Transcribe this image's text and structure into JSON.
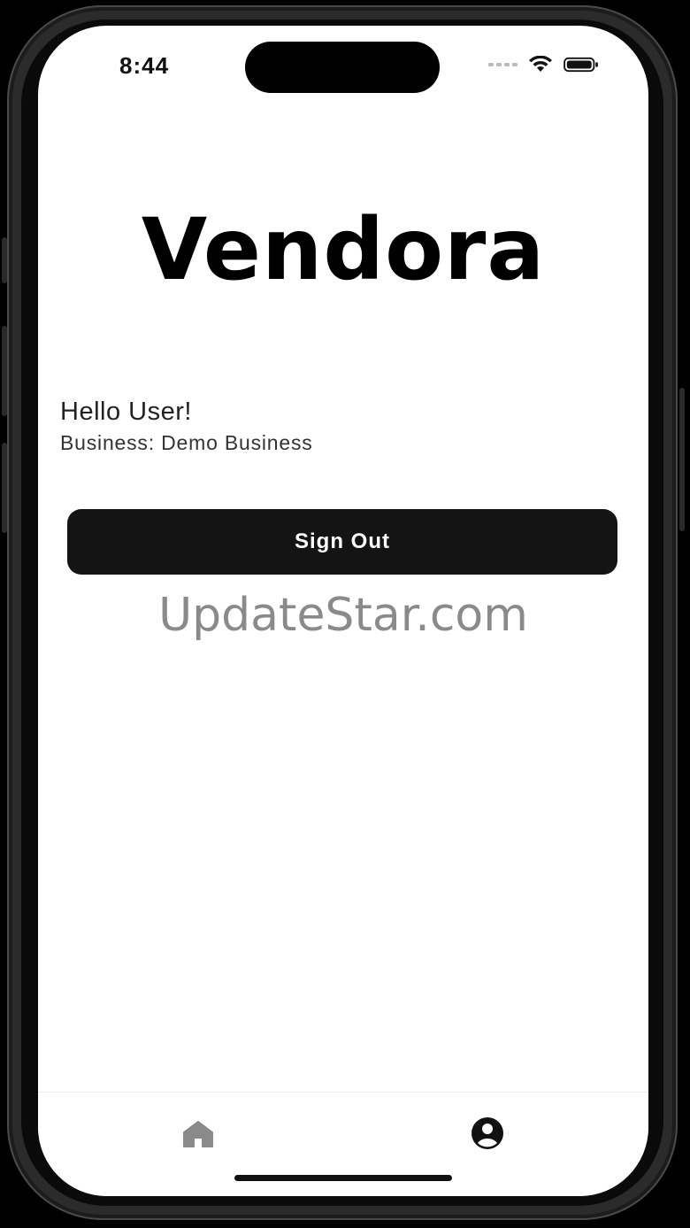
{
  "status_bar": {
    "time": "8:44",
    "icons": [
      "signal-dots-icon",
      "wifi-icon",
      "battery-icon"
    ]
  },
  "app": {
    "brand_title": "Vendora"
  },
  "profile": {
    "greeting": "Hello User!",
    "business_line": "Business: Demo Business"
  },
  "actions": {
    "sign_out_label": "Sign Out"
  },
  "watermark": {
    "text": "UpdateStar.com"
  },
  "tab_bar": {
    "tabs": [
      {
        "icon": "home-icon",
        "active": false
      },
      {
        "icon": "user-circle-icon",
        "active": true
      }
    ]
  },
  "colors": {
    "button_bg": "#141414",
    "text_primary": "#000000",
    "tab_inactive": "#8a8a8a",
    "tab_active": "#111111",
    "watermark": "#8a8a8a"
  }
}
